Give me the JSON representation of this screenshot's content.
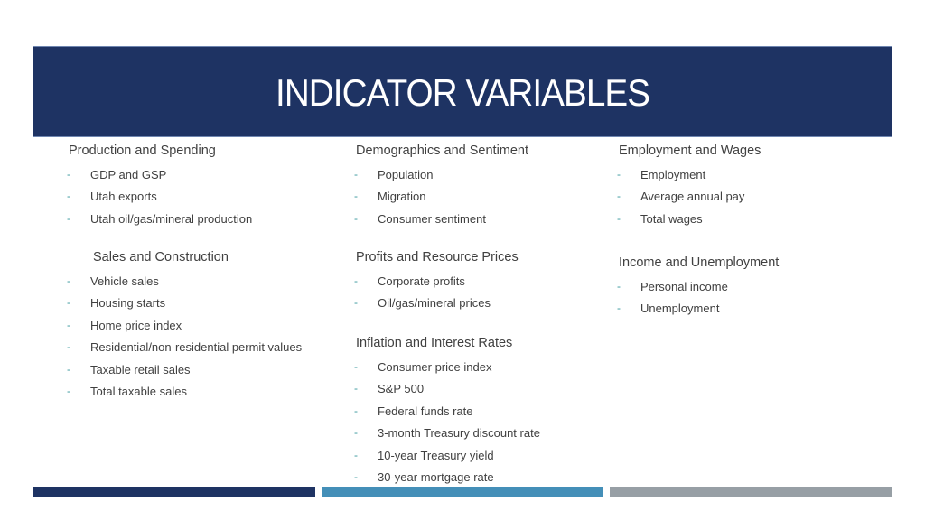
{
  "title": "INDICATOR VARIABLES",
  "colors": {
    "banner": "#1e3363",
    "bullet": "#3d9a9f",
    "bar_left": "#1e3363",
    "bar_middle": "#448fb8",
    "bar_right": "#979fa5"
  },
  "bullet_glyph": "-",
  "sections": [
    {
      "heading": "Production and Spending",
      "items": [
        "GDP and GSP",
        "Utah exports",
        "Utah oil/gas/mineral production"
      ]
    },
    {
      "heading": "Sales and Construction",
      "items": [
        "Vehicle sales",
        "Housing starts",
        "Home price index",
        "Residential/non-residential permit values",
        "Taxable retail sales",
        "Total taxable sales"
      ]
    },
    {
      "heading": "Demographics and Sentiment",
      "items": [
        "Population",
        "Migration",
        "Consumer sentiment"
      ]
    },
    {
      "heading": "Profits and Resource Prices",
      "items": [
        "Corporate profits",
        "Oil/gas/mineral prices"
      ]
    },
    {
      "heading": "Inflation and Interest Rates",
      "items": [
        "Consumer price index",
        "S&P 500",
        "Federal funds rate",
        "3-month Treasury discount rate",
        "10-year Treasury yield",
        "30-year mortgage rate"
      ]
    },
    {
      "heading": "Employment and Wages",
      "items": [
        "Employment",
        "Average annual pay",
        "Total wages"
      ]
    },
    {
      "heading": "Income and Unemployment",
      "items": [
        "Personal income",
        "Unemployment"
      ]
    }
  ]
}
